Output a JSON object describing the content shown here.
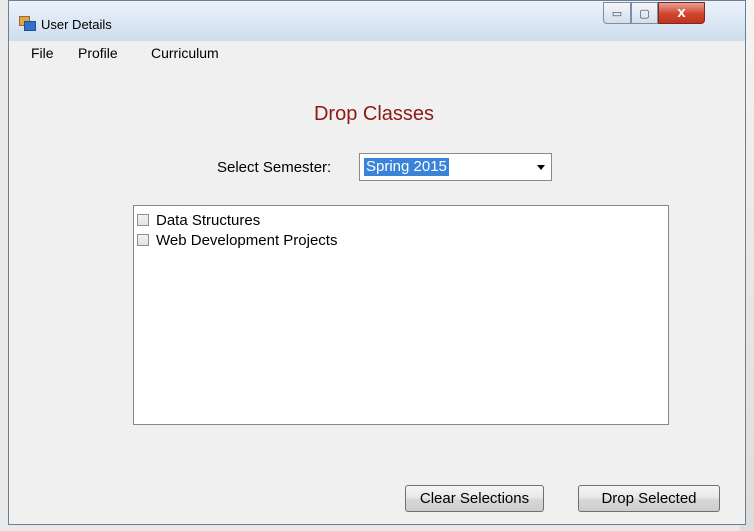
{
  "window": {
    "title": "User Details",
    "controls": {
      "minimize": "▭",
      "maximize": "▢",
      "close": "X"
    }
  },
  "menu": [
    "File",
    "Profile",
    "Curriculum"
  ],
  "page": {
    "heading": "Drop Classes",
    "semester_label": "Select Semester:",
    "semester_value": "Spring 2015",
    "classes": [
      {
        "label": "Data Structures",
        "checked": false
      },
      {
        "label": "Web Development Projects",
        "checked": false
      }
    ]
  },
  "buttons": {
    "clear": "Clear Selections",
    "drop": "Drop Selected"
  },
  "colors": {
    "heading": "#8b1a14",
    "selection": "#3a84d8",
    "close_button": "#c1321d"
  }
}
